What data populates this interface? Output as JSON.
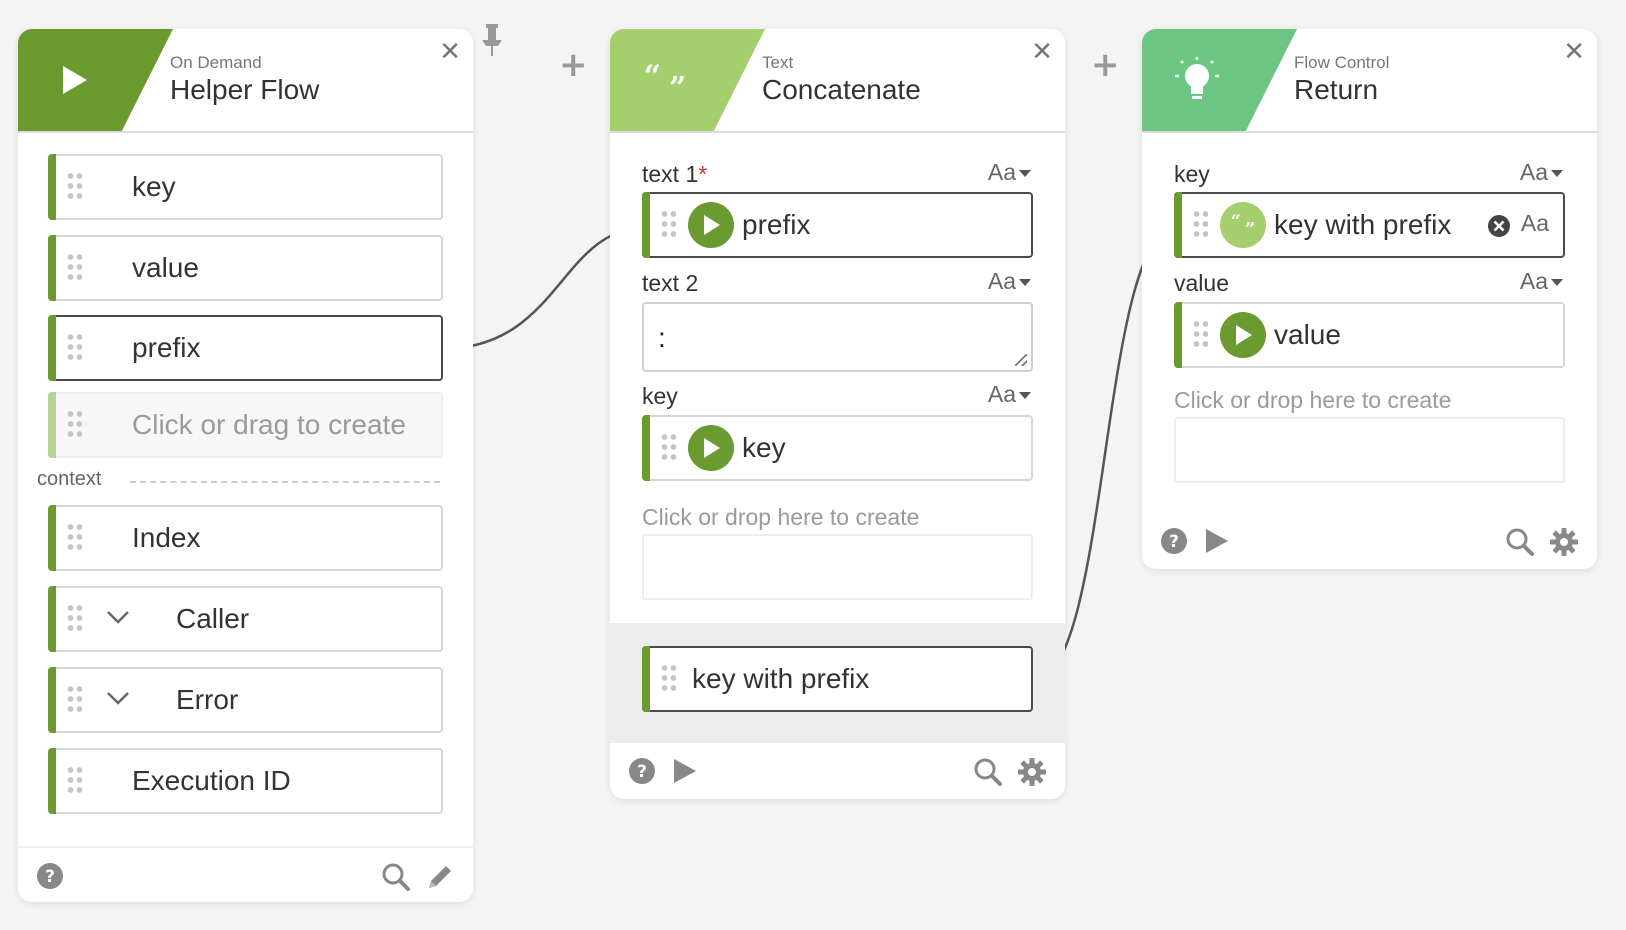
{
  "colors": {
    "accent_dark": "#6a9a30",
    "accent_light": "#a5cf6d",
    "flow_control": "#6cc683"
  },
  "trigger_card": {
    "subtitle": "On Demand",
    "title": "Helper Flow",
    "icon": "play-icon",
    "inputs": [
      "key",
      "value",
      "prefix"
    ],
    "create_hint": "Click or drag to create",
    "context_label": "context",
    "context_items": [
      {
        "label": "Index",
        "expandable": false
      },
      {
        "label": "Caller",
        "expandable": true
      },
      {
        "label": "Error",
        "expandable": true
      },
      {
        "label": "Execution ID",
        "expandable": false
      }
    ]
  },
  "concat_card": {
    "subtitle": "Text",
    "title": "Concatenate",
    "icon": "quotes-icon",
    "field1": {
      "label": "text 1",
      "required_mark": "*",
      "type_toggle": "Aa",
      "ref_value": "prefix"
    },
    "field2": {
      "label": "text 2",
      "type_toggle": "Aa",
      "value": ":"
    },
    "field3": {
      "label": "key",
      "type_toggle": "Aa",
      "ref_value": "key"
    },
    "create_hint": "Click or drop here to create",
    "output_label": "key with prefix"
  },
  "return_card": {
    "subtitle": "Flow Control",
    "title": "Return",
    "icon": "lightbulb-icon",
    "field1": {
      "label": "key",
      "type_toggle": "Aa",
      "ref_value": "key with prefix",
      "inline_toggle": "Aa"
    },
    "field2": {
      "label": "value",
      "type_toggle": "Aa",
      "ref_value": "value"
    },
    "create_hint": "Click or drop here to create"
  }
}
